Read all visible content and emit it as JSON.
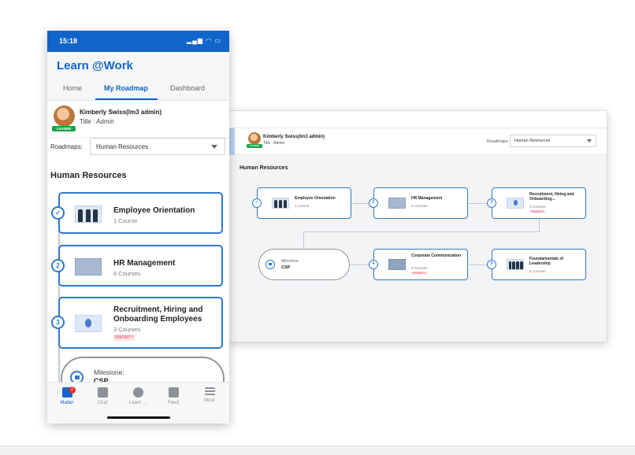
{
  "colors": {
    "brand": "#1164c9",
    "card_border": "#2f79c9",
    "priority": "#d0334f",
    "leader": "#17a34a"
  },
  "user": {
    "name": "Kimberly Swiss(lm3 admin)",
    "title": "Title : Admin",
    "badge": "LEADER"
  },
  "roadmap": {
    "label": "Roadmaps:",
    "selected": "Human Resources",
    "section_title": "Human Resources"
  },
  "mobile": {
    "time": "15:18",
    "status_icons": "▂▄▆ ◠ ▭",
    "app_title": "Learn @Work",
    "tabs": [
      {
        "label": "Home"
      },
      {
        "label": "My Roadmap"
      },
      {
        "label": "Dashboard"
      }
    ],
    "courses": [
      {
        "step": "✓",
        "title": "Employee Orientation",
        "count": "1 Course"
      },
      {
        "step": "2",
        "title": "HR Management",
        "count": "6 Courses"
      },
      {
        "step": "3",
        "title": "Recruitment, Hiring and Onboarding Employees",
        "count": "3 Courses",
        "priority": "PRIORITY"
      }
    ],
    "milestone": {
      "label": "Milestone:",
      "value": "CSP"
    },
    "nav": [
      {
        "label": "Matter",
        "icon": "matter-icon",
        "badge": "2"
      },
      {
        "label": "Chat",
        "icon": "chat-icon"
      },
      {
        "label": "Learn ...",
        "icon": "learn-icon"
      },
      {
        "label": "Feed",
        "icon": "feed-icon"
      },
      {
        "label": "More",
        "icon": "menu-icon"
      }
    ]
  },
  "desktop": {
    "user_name": "Kimberly Swiss(lm3 admin)",
    "user_title": "Title : Admin",
    "roadmap_label": "Roadmaps:",
    "courses": [
      {
        "step": "✓",
        "title": "Employee Orientation",
        "count": "1 Course"
      },
      {
        "step": "2",
        "title": "HR Management",
        "count": "6 Courses"
      },
      {
        "step": "3",
        "title": "Recruitment, Hiring and Onboarding...",
        "count": "3 Courses",
        "priority": "PRIORITY"
      },
      {
        "step": "4",
        "title": "Corporate Communication",
        "count": "2 Courses",
        "priority": "PRIORITY"
      },
      {
        "step": "5",
        "title": "Foundamentals of Leadership",
        "count": "6 Courses"
      }
    ],
    "milestone": {
      "label": "Milestone:",
      "value": "CSP"
    }
  }
}
